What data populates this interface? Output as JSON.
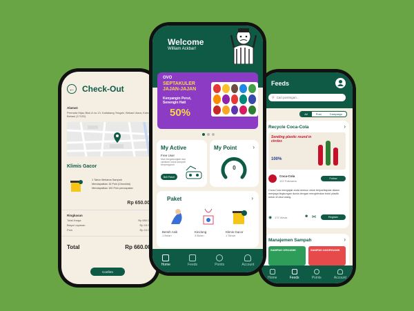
{
  "checkout": {
    "title": "Check-Out",
    "address_label": "Alamat:",
    "address_text": "Permata Hijau Blok A no.13, Kaliabang Tengah, Bekasi Utara, Kota Bekasi (17125)",
    "store_name": "Klimis Gacor",
    "items": [
      "1 Tahun Berlama Sampah",
      "Mendapatkan 15 Poin (Checklist)",
      "Mendapatkan 100 Poin pencapaian"
    ],
    "subtotal": "Rp 650.000",
    "summary_title": "Ringkasan",
    "summary_rows": [
      {
        "label": "Total Harga",
        "value": "Rp 650.000"
      },
      {
        "label": "Biaya Layanan",
        "value": "Rp 10.000"
      },
      {
        "label": "Poin",
        "value": "Rp 10.000"
      }
    ],
    "total_label": "Total",
    "total_value": "Rp 660.000",
    "confirm_label": "Confirm"
  },
  "home": {
    "welcome": "Welcome",
    "user_name": "William Ackbar!",
    "banner_brand": "OVO",
    "banner_title": "SEPTAKULER JAJAN-JAJAN",
    "banner_sub": "Kenyangin Perut, Senengin Hati",
    "banner_pct": "50%",
    "active_title": "My Active",
    "active_sub": "Free User",
    "active_desc": "Mari bergabunglah dan ciptakan untuk sampah berpengaruh",
    "active_btn": "Beli Paket",
    "point_title": "My Point",
    "point_value": "0",
    "paket_title": "Paket",
    "paket_items": [
      {
        "name": "Bersih Asik",
        "sub": "1 Bulan"
      },
      {
        "name": "Kinclong",
        "sub": "3 Bulan"
      },
      {
        "name": "Klimis Gacor",
        "sub": "1 Tahun"
      }
    ],
    "nav": [
      "Home",
      "Feeds",
      "Points",
      "Account"
    ]
  },
  "feeds": {
    "title": "Feeds",
    "search_placeholder": "Cari postingan...",
    "tabs": [
      "All",
      "Post",
      "Campaign"
    ],
    "post_title": "Recycle Coca-Cola",
    "post_img_text": "Sending plastic round in circles",
    "post_pct": "100%",
    "account_name": "Coca-Cola",
    "account_followers": "122 Followers",
    "follow_label": "Follow",
    "post_desc": "Coca-Cola mengajak anda semua untuk berpartisipasi dalam menjaga lingkungan dunia dengan mengirimkan botol plastik untuk di daur ulang.",
    "views": "172 Views",
    "register_label": "Register",
    "section2_title": "Manajemen Sampah",
    "sampah1": "SAMPAH ORGANIK",
    "sampah2": "SAMPAH ANORGANIK",
    "nav": [
      "Home",
      "Feeds",
      "Points",
      "Account"
    ]
  }
}
